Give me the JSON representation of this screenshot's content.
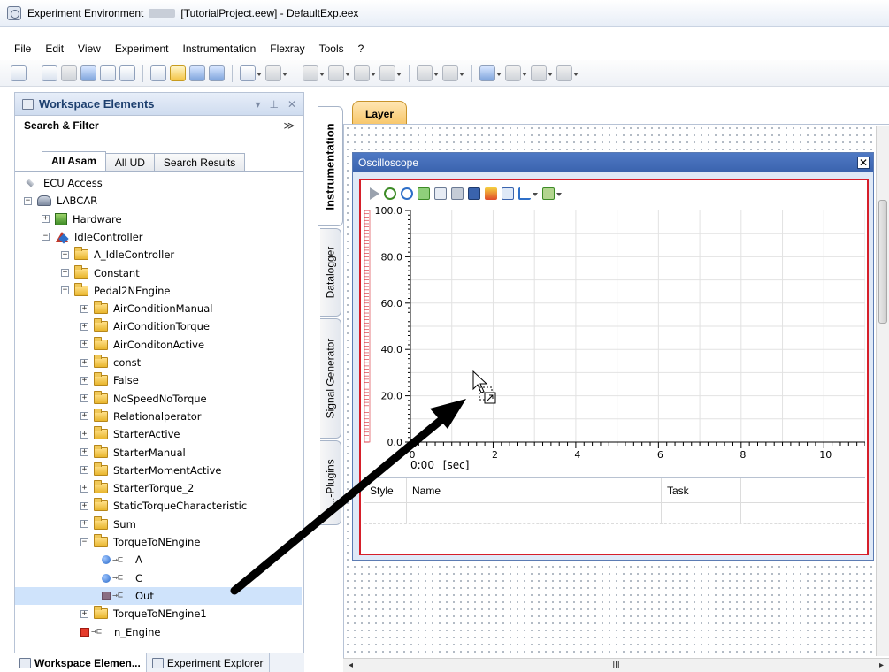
{
  "window": {
    "title_prefix": "Experiment Environment",
    "title_suffix": "[TutorialProject.eew] - DefaultExp.eex"
  },
  "menu": [
    "File",
    "Edit",
    "View",
    "Experiment",
    "Instrumentation",
    "Flexray",
    "Tools",
    "?"
  ],
  "workspace": {
    "title": "Workspace Elements",
    "search_filter": "Search & Filter",
    "tabs": [
      "All Asam",
      "All UD",
      "Search Results"
    ],
    "tree": [
      {
        "label": "ECU Access",
        "icon": "ecu-icon",
        "depth": 0,
        "expander": ""
      },
      {
        "label": "LABCAR",
        "icon": "labcar-icon",
        "depth": 0,
        "expander": "-"
      },
      {
        "label": "Hardware",
        "icon": "hardware-icon",
        "depth": 1,
        "expander": "+"
      },
      {
        "label": "IdleController",
        "icon": "controller-icon",
        "depth": 1,
        "expander": "-"
      },
      {
        "label": "A_IdleController",
        "icon": "folder-icon",
        "depth": 2,
        "expander": "+"
      },
      {
        "label": "Constant",
        "icon": "folder-icon",
        "depth": 2,
        "expander": "+"
      },
      {
        "label": "Pedal2NEngine",
        "icon": "folder-icon",
        "depth": 2,
        "expander": "-"
      },
      {
        "label": "AirConditionManual",
        "icon": "folder-icon",
        "depth": 3,
        "expander": "+"
      },
      {
        "label": "AirConditionTorque",
        "icon": "folder-icon",
        "depth": 3,
        "expander": "+"
      },
      {
        "label": "AirConditonActive",
        "icon": "folder-icon",
        "depth": 3,
        "expander": "+"
      },
      {
        "label": "const",
        "icon": "folder-icon",
        "depth": 3,
        "expander": "+"
      },
      {
        "label": "False",
        "icon": "folder-icon",
        "depth": 3,
        "expander": "+"
      },
      {
        "label": "NoSpeedNoTorque",
        "icon": "folder-icon",
        "depth": 3,
        "expander": "+"
      },
      {
        "label": "Relationalperator",
        "icon": "folder-icon",
        "depth": 3,
        "expander": "+"
      },
      {
        "label": "StarterActive",
        "icon": "folder-icon",
        "depth": 3,
        "expander": "+"
      },
      {
        "label": "StarterManual",
        "icon": "folder-icon",
        "depth": 3,
        "expander": "+"
      },
      {
        "label": "StarterMomentActive",
        "icon": "folder-icon",
        "depth": 3,
        "expander": "+"
      },
      {
        "label": "StarterTorque_2",
        "icon": "folder-icon",
        "depth": 3,
        "expander": "+"
      },
      {
        "label": "StaticTorqueCharacteristic",
        "icon": "folder-icon",
        "depth": 3,
        "expander": "+"
      },
      {
        "label": "Sum",
        "icon": "folder-icon",
        "depth": 3,
        "expander": "+"
      },
      {
        "label": "TorqueToNEngine",
        "icon": "folder-icon",
        "depth": 3,
        "expander": "-"
      },
      {
        "label": "A",
        "icon": "signal-in-icon",
        "depth": 4,
        "expander": ""
      },
      {
        "label": "C",
        "icon": "signal-in-icon",
        "depth": 4,
        "expander": ""
      },
      {
        "label": "Out",
        "icon": "signal-out-icon",
        "depth": 4,
        "expander": "",
        "selected": true
      },
      {
        "label": "TorqueToNEngine1",
        "icon": "folder-icon",
        "depth": 3,
        "expander": "+"
      },
      {
        "label": "n_Engine",
        "icon": "signal-red-icon",
        "depth": 3,
        "expander": ""
      }
    ],
    "bottom_tabs": [
      "Workspace Elemen...",
      "Experiment Explorer"
    ]
  },
  "side_tabs": [
    "Instrumentation",
    "Datalogger",
    "Signal Generator",
    "...-Plugins"
  ],
  "layer_tab": "Layer",
  "oscilloscope": {
    "title": "Oscilloscope",
    "time_readout": "0:00",
    "time_unit": "[sec]",
    "table_headers": [
      "Style",
      "Name",
      "Task"
    ]
  },
  "chart_data": {
    "type": "line",
    "xlim": [
      0,
      11
    ],
    "ylim": [
      0,
      100
    ],
    "x_ticks": [
      0,
      2,
      4,
      6,
      8,
      10
    ],
    "y_ticks": [
      "0.0",
      "20.0",
      "40.0",
      "60.0",
      "80.0",
      "100.0"
    ],
    "grid": true,
    "series": []
  },
  "colors": {
    "accent_blue": "#3a63ad",
    "selection_border": "#d61f2a",
    "arrow": "#000000"
  },
  "hscroll_label": "III"
}
